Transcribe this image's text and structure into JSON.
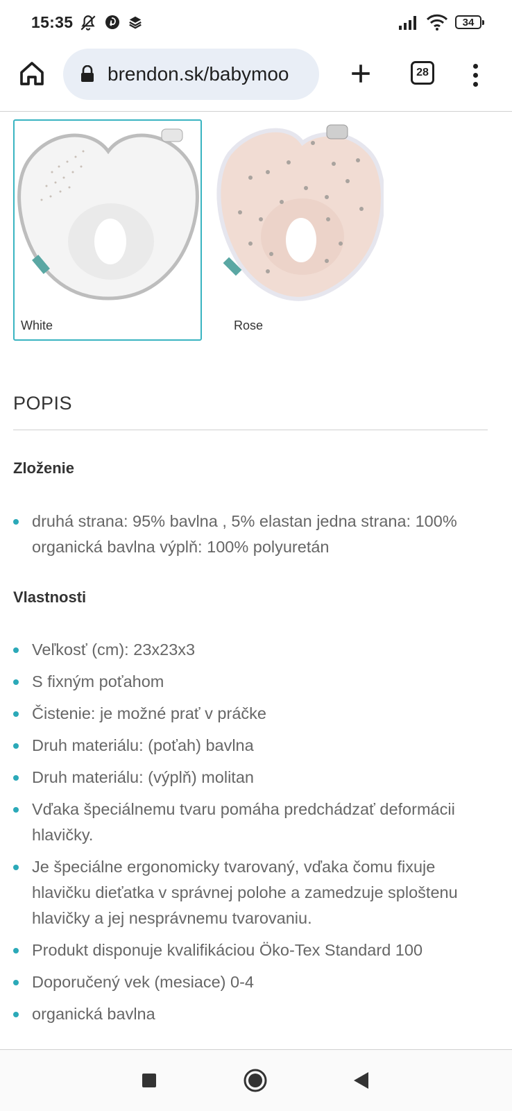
{
  "status_bar": {
    "time": "15:35",
    "battery": "34"
  },
  "browser": {
    "url": "brendon.sk/babymoo",
    "tab_count": "28"
  },
  "variants": [
    {
      "label": "White",
      "selected": true,
      "color": "#f2f2f2"
    },
    {
      "label": "Rose",
      "selected": false,
      "color": "#f1dcd3"
    }
  ],
  "description": {
    "title": "POPIS",
    "composition_heading": "Zloženie",
    "composition": [
      "druhá strana: 95% bavlna , 5% elastan jedna strana: 100% organická bavlna výplň: 100% polyuretán"
    ],
    "properties_heading": "Vlastnosti",
    "properties": [
      "Veľkosť (cm): 23x23x3",
      "S fixným poťahom",
      "Čistenie: je možné prať v práčke",
      "Druh materiálu: (poťah) bavlna",
      "Druh materiálu: (výplň) molitan",
      "Vďaka špeciálnemu tvaru pomáha predchádzať deformácii hlavičky.",
      "Je špeciálne ergonomicky tvarovaný, vďaka čomu fixuje hlavičku dieťatka v správnej polohe a zamedzuje sploštenu hlavičky a jej nesprávnemu tvarovaniu.",
      "Produkt disponuje kvalifikáciou Öko-Tex Standard 100",
      "Doporučený vek (mesiace) 0-4",
      "organická bavlna"
    ]
  },
  "colors": {
    "accent": "#2ba9b8",
    "url_bar": "#e9eef6"
  },
  "icons": [
    "silent-bell-icon",
    "pinterest-icon",
    "layers-icon",
    "signal-icon",
    "wifi-icon",
    "battery-icon",
    "home-icon",
    "lock-icon",
    "plus-icon",
    "tabs-icon",
    "more-icon",
    "stop-icon",
    "home-circle-icon",
    "back-icon"
  ]
}
